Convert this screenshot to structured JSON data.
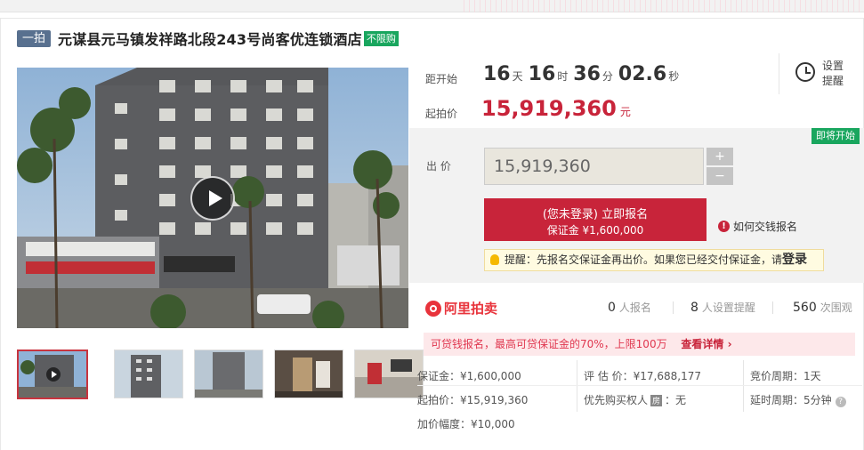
{
  "header": {
    "tag": "一拍",
    "title": "元谋县元马镇发祥路北段243号尚客优连锁酒店",
    "limit_tag": "不限购"
  },
  "countdown": {
    "label": "距开始",
    "days": "16",
    "days_unit": "天",
    "hours": "16",
    "hours_unit": "时",
    "minutes": "36",
    "minutes_unit": "分",
    "seconds": "02.6",
    "seconds_unit": "秒"
  },
  "reminder": {
    "label": "设置提醒"
  },
  "start_price": {
    "label": "起拍价",
    "value": "15,919,360",
    "unit": "元"
  },
  "bid": {
    "status_badge": "即将开始",
    "label": "出 价",
    "input_value": "15,919,360",
    "plus": "+",
    "minus": "−",
    "signup_line1": "(您未登录) 立即报名",
    "signup_line2": "保证金 ¥1,600,000",
    "howto": "如何交钱报名",
    "tip_text": "提醒：先报名交保证金再出价。如果您已经交付保证金，请",
    "tip_login": "登录"
  },
  "platform": {
    "name": "阿里拍卖",
    "signups_count": "0",
    "signups_label": "人报名",
    "reminders_count": "8",
    "reminders_label": "人设置提醒",
    "views_count": "560",
    "views_label": "次围观"
  },
  "promo": {
    "text": "可贷钱报名，最高可贷保证金的70%，上限100万",
    "detail": "查看详情 ›"
  },
  "info": {
    "deposit": "保证金：¥1,600,000",
    "appraisal": "评 估 价：¥17,688,177",
    "cycle": "竞价周期：1天",
    "start": "起拍价：¥15,919,360",
    "priority_prefix": "优先购买权人",
    "priority_badge": "房",
    "priority_value": "：无",
    "delay": "延时周期：5分钟",
    "increment": "加价幅度：¥10,000"
  }
}
